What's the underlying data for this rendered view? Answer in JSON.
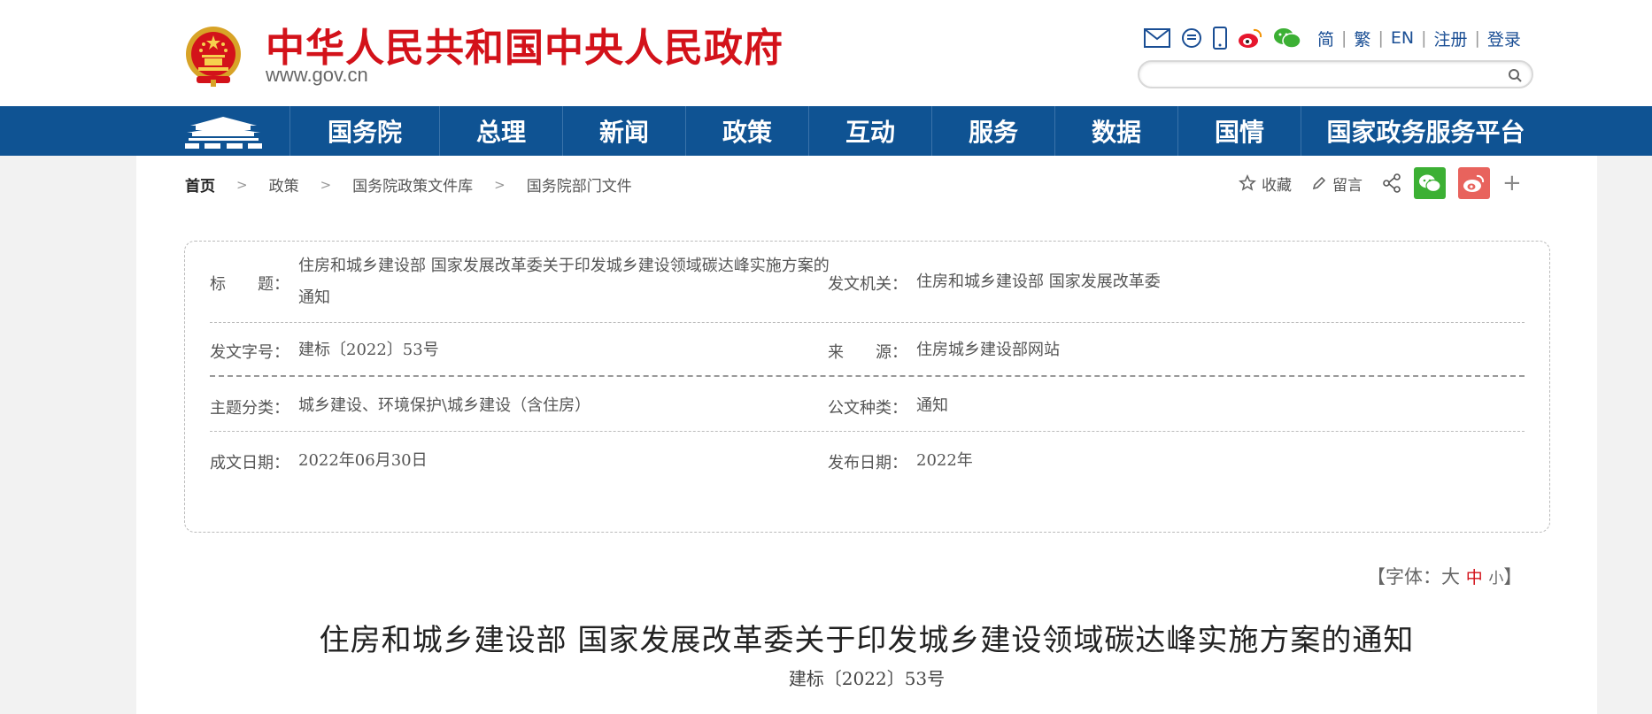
{
  "header": {
    "site_title": "中华人民共和国中央人民政府",
    "site_domain": "www.gov.cn",
    "icons": [
      "mail-icon",
      "message-icon",
      "mobile-icon",
      "weibo-icon",
      "wechat-icon"
    ],
    "lang": {
      "simplified": "简",
      "traditional": "繁",
      "english": "EN",
      "register": "注册",
      "login": "登录"
    },
    "search": {
      "value": "",
      "placeholder": ""
    }
  },
  "nav": {
    "home_icon": "tiananmen-icon",
    "items": [
      {
        "label": "国务院"
      },
      {
        "label": "总理"
      },
      {
        "label": "新闻"
      },
      {
        "label": "政策"
      },
      {
        "label": "互动"
      },
      {
        "label": "服务"
      },
      {
        "label": "数据"
      },
      {
        "label": "国情"
      },
      {
        "label": "国家政务服务平台"
      }
    ]
  },
  "breadcrumb": [
    "首页",
    "政策",
    "国务院政策文件库",
    "国务院部门文件"
  ],
  "tools": {
    "favorite": "收藏",
    "comment": "留言",
    "more": "+"
  },
  "info": {
    "title_label": "标　　题：",
    "title_value": "住房和城乡建设部 国家发展改革委关于印发城乡建设领域碳达峰实施方案的通知",
    "issuer_label": "发文机关：",
    "issuer_value": "住房和城乡建设部 国家发展改革委",
    "docno_label": "发文字号：",
    "docno_value": "建标〔2022〕53号",
    "source_label": "来　　源：",
    "source_value": "住房城乡建设部网站",
    "topic_label": "主题分类：",
    "topic_value": "城乡建设、环境保护\\城乡建设（含住房）",
    "type_label": "公文种类：",
    "type_value": "通知",
    "written_label": "成文日期：",
    "written_value": "2022年06月30日",
    "published_label": "发布日期：",
    "published_value": "2022年"
  },
  "fontsize": {
    "open": "【字体：",
    "large": "大",
    "medium": "中",
    "small": "小",
    "close": "】"
  },
  "document": {
    "title": "住房和城乡建设部 国家发展改革委关于印发城乡建设领域碳达峰实施方案的通知",
    "number": "建标〔2022〕53号"
  },
  "colors": {
    "brand_red": "#d3121a",
    "nav_blue": "#0f5393",
    "wechat_green": "#3cb034",
    "weibo_red": "#e8635d"
  }
}
